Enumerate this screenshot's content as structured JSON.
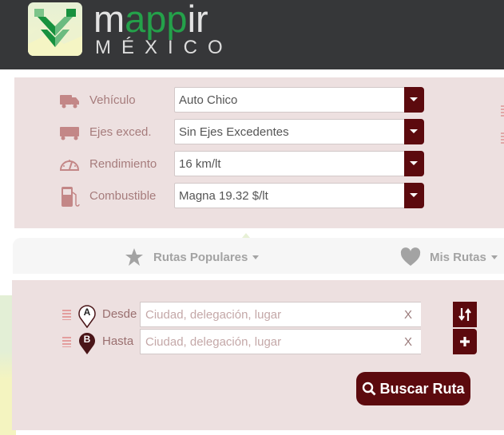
{
  "header": {
    "logo_prefix": "m",
    "logo_highlight": "app",
    "logo_suffix": "ir",
    "logo_subtitle": "MÉXICO"
  },
  "vehicle_settings": [
    {
      "icon": "truck-icon",
      "label": "Vehículo",
      "value": "Auto Chico"
    },
    {
      "icon": "trailer-icon",
      "label": "Ejes exced.",
      "value": "Sin Ejes Excedentes"
    },
    {
      "icon": "speedometer-icon",
      "label": "Rendimiento",
      "value": "16 km/lt"
    },
    {
      "icon": "fuel-pump-icon",
      "label": "Combustible",
      "value": "Magna 19.32 $/lt"
    }
  ],
  "tabs": [
    {
      "icon": "star-icon",
      "label": "Rutas Populares"
    },
    {
      "icon": "heart-icon",
      "label": "Mis Rutas"
    }
  ],
  "route": {
    "from": {
      "marker": "A",
      "label": "Desde",
      "placeholder": "Ciudad, delegación, lugar",
      "value": "",
      "clear": "X"
    },
    "to": {
      "marker": "B",
      "label": "Hasta",
      "placeholder": "Ciudad, delegación, lugar",
      "value": "",
      "clear": "X"
    },
    "search_label": "Buscar Ruta"
  },
  "colors": {
    "accent": "#5c0a0e",
    "panel": "#ede0e0",
    "header": "#363739",
    "logo_green": "#24a14a"
  }
}
